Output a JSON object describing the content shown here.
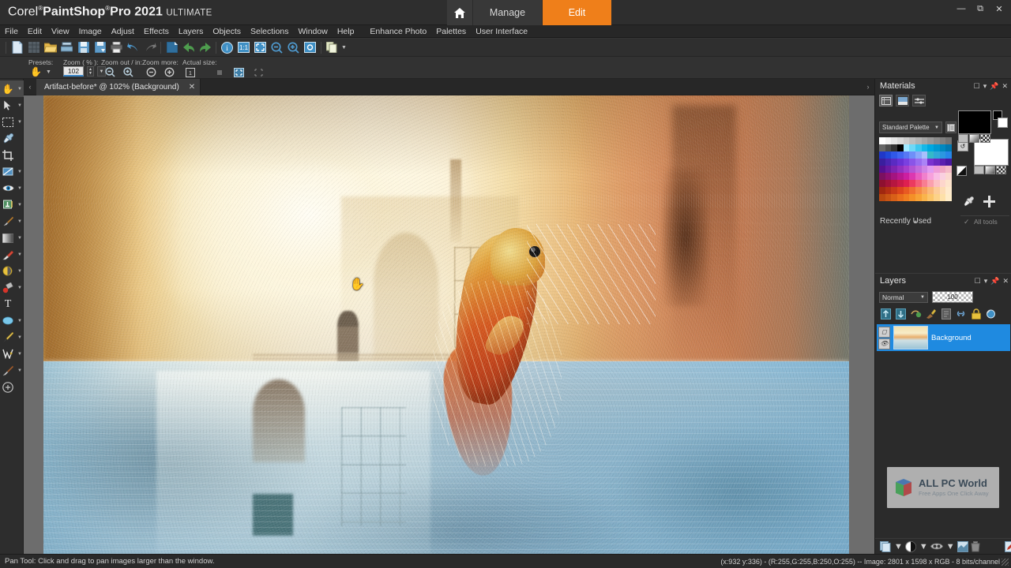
{
  "app": {
    "brand_corel": "Corel",
    "brand_product": "PaintShop",
    "brand_pro": "Pro 2021",
    "brand_edition": "ULTIMATE"
  },
  "titlebar": {
    "home_icon": "home-icon",
    "tabs": [
      {
        "label": "Manage",
        "active": false
      },
      {
        "label": "Edit",
        "active": true
      }
    ],
    "window_controls": {
      "minimize": "minimize-icon",
      "restore": "restore-icon",
      "close": "close-icon"
    },
    "accent_color": "#ef7f1a"
  },
  "menubar": {
    "items": [
      "File",
      "Edit",
      "View",
      "Image",
      "Adjust",
      "Effects",
      "Layers",
      "Objects",
      "Selections",
      "Window",
      "Help"
    ],
    "items_right": [
      "Enhance Photo",
      "Palettes",
      "User Interface"
    ]
  },
  "toolbar": {
    "buttons": [
      "new-image-icon",
      "new-from-template-icon",
      "open-icon",
      "scanner-icon",
      "save-icon",
      "save-as-icon",
      "print-icon",
      "undo-icon",
      "redo-icon",
      "revert-icon",
      "undo-history-back-icon",
      "redo-history-forward-icon",
      "image-info-icon",
      "actual-size-icon",
      "fit-to-window-icon",
      "zoom-out-icon",
      "zoom-in-icon",
      "full-screen-preview-icon",
      "duplicate-icon"
    ]
  },
  "optionsbar": {
    "tool_preset_label": "Presets:",
    "zoom_label": "Zoom ( % ):",
    "zoom_value": "102",
    "zoom_out_in_label": "Zoom out / in:",
    "zoom_more_label": "Zoom more:",
    "actual_size_label": "Actual size:"
  },
  "tools": [
    {
      "name": "pan-tool",
      "icon": "hand-icon",
      "active": true,
      "flyout": true
    },
    {
      "name": "pick-tool",
      "icon": "arrow-icon",
      "active": false,
      "flyout": true
    },
    {
      "name": "selection-tool",
      "icon": "marquee-icon",
      "active": false,
      "flyout": true
    },
    {
      "name": "dropper-tool",
      "icon": "eyedropper-icon",
      "active": false,
      "flyout": false
    },
    {
      "name": "crop-tool",
      "icon": "crop-icon",
      "active": false,
      "flyout": false
    },
    {
      "name": "straighten-tool",
      "icon": "straighten-icon",
      "active": false,
      "flyout": true
    },
    {
      "name": "red-eye-tool",
      "icon": "eye-icon",
      "active": false,
      "flyout": true
    },
    {
      "name": "makeover-tool",
      "icon": "makeover-icon",
      "active": false,
      "flyout": true
    },
    {
      "name": "paint-brush-tool",
      "icon": "brush-icon",
      "active": false,
      "flyout": true
    },
    {
      "name": "gradient-tool",
      "icon": "gradient-icon",
      "active": false,
      "flyout": true
    },
    {
      "name": "eraser-tool",
      "icon": "eraser-icon",
      "active": false,
      "flyout": true
    },
    {
      "name": "color-changer-tool",
      "icon": "color-changer-icon",
      "active": false,
      "flyout": true
    },
    {
      "name": "flood-fill-tool",
      "icon": "flood-fill-icon",
      "active": false,
      "flyout": true
    },
    {
      "name": "text-tool",
      "icon": "text-icon",
      "active": false,
      "flyout": false
    },
    {
      "name": "preset-shape-tool",
      "icon": "shape-icon",
      "active": false,
      "flyout": true
    },
    {
      "name": "pen-tool",
      "icon": "pen-icon",
      "active": false,
      "flyout": true
    },
    {
      "name": "warp-brush-tool",
      "icon": "warp-icon",
      "active": false,
      "flyout": true
    },
    {
      "name": "clone-brush-tool",
      "icon": "clone-icon",
      "active": false,
      "flyout": true
    },
    {
      "name": "more-tools",
      "icon": "plus-circle-icon",
      "active": false,
      "flyout": false
    }
  ],
  "document": {
    "tab_label": "Artifact-before* @ 102% (Background)",
    "close_icon": "close-icon",
    "scroll_left_icon": "chevron-left-icon",
    "scroll_right_icon": "chevron-right-icon"
  },
  "materials": {
    "title": "Materials",
    "mode_buttons": [
      "frame-tab-icon",
      "rainbow-tab-icon",
      "swatches-tab-icon"
    ],
    "palette_name": "Standard Palette",
    "palette_menu_icon": "palette-list-icon",
    "foreground_color": "#000000",
    "background_color": "#ffffff",
    "tools": [
      "eyedropper-icon",
      "add-swatch-icon"
    ],
    "all_tools_label": "All tools",
    "all_tools_checked": true,
    "header_controls": [
      "maximize-icon",
      "menu-icon",
      "pin-icon",
      "close-icon"
    ]
  },
  "recently_used": {
    "title": "Recently Used"
  },
  "layers": {
    "title": "Layers",
    "blend_mode": "Normal",
    "opacity": "100",
    "toolbar_icons": [
      "new-raster-layer-icon",
      "new-vector-layer-icon",
      "new-mask-layer-icon",
      "new-art-media-layer-icon",
      "duplicate-layer-icon",
      "link-icon",
      "lock-icon",
      "layer-properties-icon"
    ],
    "rows": [
      {
        "name": "Background",
        "visible": true,
        "selected": true
      }
    ],
    "footer_icons": [
      "new-layer-icon",
      "new-adjustment-layer-icon",
      "new-mask-icon",
      "merge-icon",
      "delete-layer-icon",
      "layer-effects-icon"
    ],
    "selected_color": "#1f8ae0"
  },
  "watermark": {
    "title": "ALL PC World",
    "tagline": "Free Apps One Click Away"
  },
  "statusbar": {
    "hint": "Pan Tool: Click and drag to pan images larger than the window.",
    "info": "(x:932 y:336) - (R:255,G:255,B:250,O:255) -- Image:  2801 x 1598 x RGB - 8 bits/channel"
  },
  "canvas": {
    "image_description": "Surreal composite: sunlit alleyway with walking figure and a leaping koi fish over a reflective blue water surface",
    "cursor": "hand-cursor"
  },
  "swatch_colors": [
    "#ffffff",
    "#f2f2f2",
    "#e6e6e6",
    "#d9d9d9",
    "#cccccc",
    "#bfbfbf",
    "#b3b3b3",
    "#a6a6a6",
    "#999999",
    "#8c8c8c",
    "#808080",
    "#737373",
    "#666666",
    "#4d4d4d",
    "#333333",
    "#000000",
    "#9fe8ff",
    "#6fd8f7",
    "#3fc8ef",
    "#17b8e8",
    "#00a8e0",
    "#0098d0",
    "#0088c0",
    "#0078b0",
    "#2038c8",
    "#2048d8",
    "#3058e8",
    "#4068f0",
    "#5878f4",
    "#6f8ff8",
    "#8aa8fa",
    "#a8c0fc",
    "#35b9c8",
    "#30a8d8",
    "#2b97e0",
    "#2686e8",
    "#3a1f9e",
    "#4a25b0",
    "#5a2bc2",
    "#6a31d4",
    "#7a40e0",
    "#8a55e8",
    "#9a6cf0",
    "#aa84f6",
    "#7a32cf",
    "#6a28c0",
    "#5a20b0",
    "#4a18a0",
    "#56108f",
    "#6a1aa0",
    "#7e24b0",
    "#9230c0",
    "#a63ecc",
    "#b455d4",
    "#c26cdc",
    "#d084e4",
    "#e29bf0",
    "#ef9bd8",
    "#f0a8c4",
    "#f5bcc8",
    "#7c1060",
    "#901070",
    "#a41480",
    "#b81890",
    "#cc1fa0",
    "#dc38b0",
    "#e85cc0",
    "#f080cc",
    "#f7a0dc",
    "#f9bce4",
    "#fad0e0",
    "#fbd8d0",
    "#8e1030",
    "#a21238",
    "#b61640",
    "#ca1a48",
    "#de2050",
    "#ec3a60",
    "#f45c78",
    "#f87e92",
    "#fba0ae",
    "#fcc0c4",
    "#fdd6cc",
    "#fde4cc",
    "#a02810",
    "#b43014",
    "#c83a18",
    "#dc461c",
    "#e85a22",
    "#f07030",
    "#f58a44",
    "#f8a25c",
    "#fab878",
    "#fccc98",
    "#fddcb4",
    "#feeacc",
    "#b84810",
    "#c85414",
    "#d86018",
    "#e86e1c",
    "#f07e20",
    "#f49028",
    "#f7a236",
    "#f9b44c",
    "#fbc468",
    "#fcd288",
    "#fde0a8",
    "#feecc8"
  ]
}
